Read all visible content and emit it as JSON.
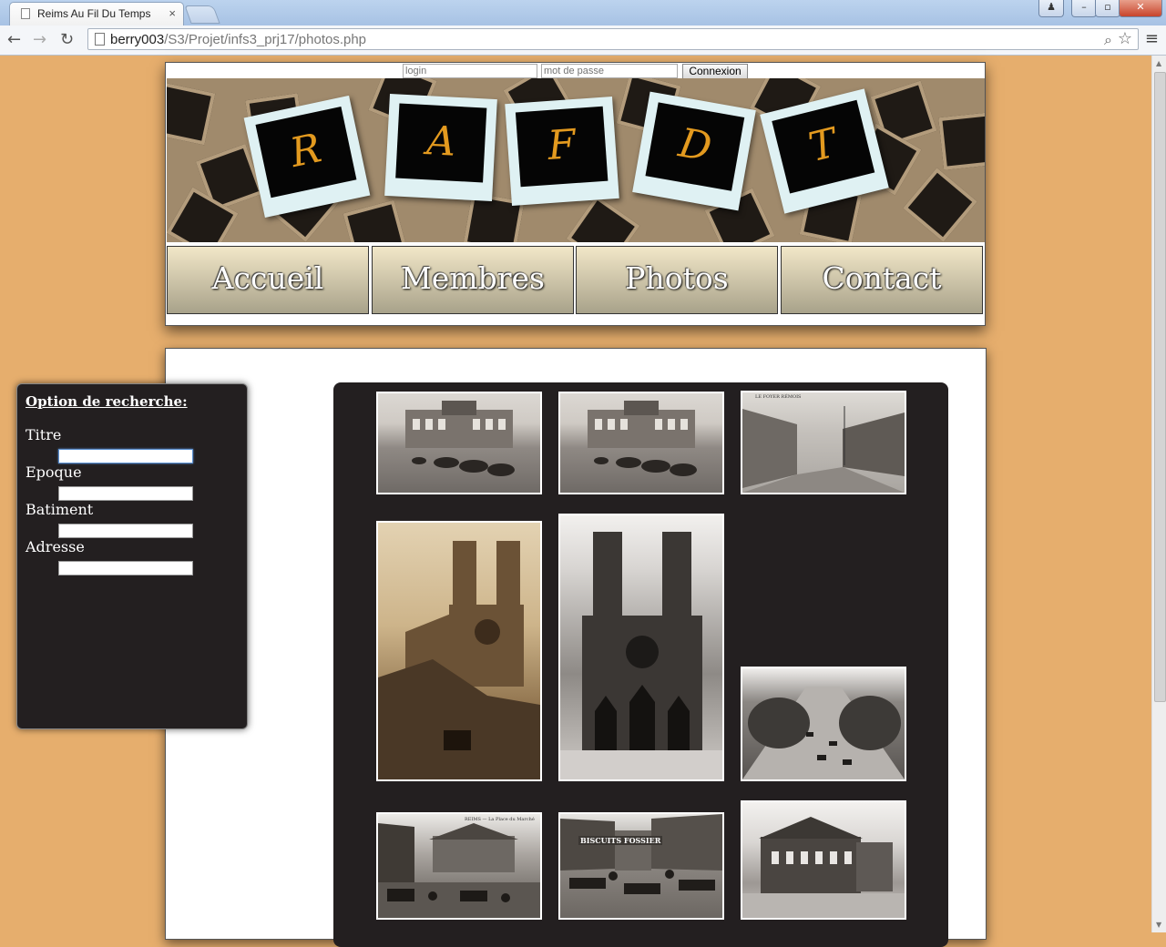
{
  "browser": {
    "tab_title": "Reims Au Fil Du Temps",
    "tab_close": "×",
    "url_host": "berry003",
    "url_path": "/S3/Projet/infs3_prj17/photos.php",
    "back": "←",
    "forward": "→",
    "reload": "↻",
    "menu": "≡",
    "win_min": "–",
    "win_max": "▫",
    "win_close": "✕",
    "user": "♟"
  },
  "login": {
    "login_placeholder": "login",
    "password_placeholder": "mot de passe",
    "connect_label": "Connexion"
  },
  "banner": {
    "letters": [
      "R",
      "A",
      "F",
      "D",
      "T"
    ]
  },
  "menu": {
    "items": [
      "Accueil",
      "Membres",
      "Photos",
      "Contact"
    ]
  },
  "search": {
    "title": "Option de recherche:",
    "fields": [
      {
        "label": "Titre",
        "value": ""
      },
      {
        "label": "Epoque",
        "value": ""
      },
      {
        "label": "Batiment",
        "value": ""
      },
      {
        "label": "Adresse",
        "value": ""
      }
    ]
  },
  "gallery": {
    "photos": [
      {
        "subject": "town-hall-square"
      },
      {
        "subject": "town-hall-square"
      },
      {
        "subject": "foyer-remois-street",
        "caption": "LE FOYER RÉMOIS"
      },
      {
        "subject": "cathedral-ruins"
      },
      {
        "subject": "cathedral-facade"
      },
      {
        "subject": "boulevard-aerial"
      },
      {
        "subject": "market-place",
        "caption": "REIMS — La Place du Marché"
      },
      {
        "subject": "market-biscuits",
        "caption": "BISCUITS FOSSIER"
      },
      {
        "subject": "theatre"
      }
    ]
  }
}
